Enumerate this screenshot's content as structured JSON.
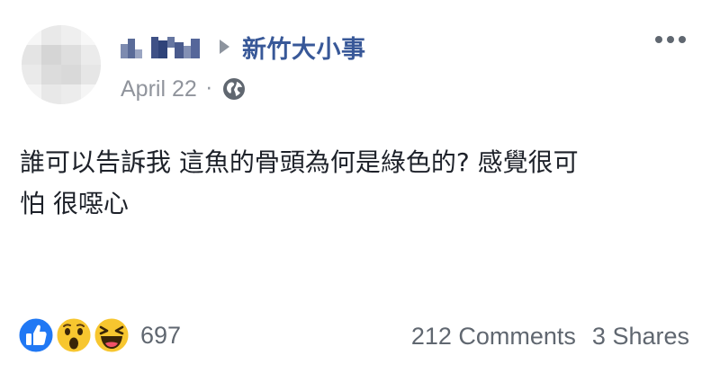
{
  "post": {
    "author": {
      "page_name": "新竹大小事"
    },
    "meta": {
      "date": "April 22",
      "separator": "·",
      "privacy_icon": "globe-icon"
    },
    "menu_icon": "more-horizontal-icon",
    "body_text": "誰可以告訴我 這魚的骨頭為何是綠色的? 感覺很可\n怕 很噁心",
    "footer": {
      "reaction_icons": [
        "like-icon",
        "wow-icon",
        "haha-icon"
      ],
      "reaction_count": "697",
      "comments": "212 Comments",
      "shares": "3 Shares"
    }
  },
  "colors": {
    "link_blue": "#385898",
    "muted_gray": "#90949c",
    "text": "#1d2129",
    "like_blue": "#2078f4",
    "emoji_yellow": "#f7c62f"
  }
}
